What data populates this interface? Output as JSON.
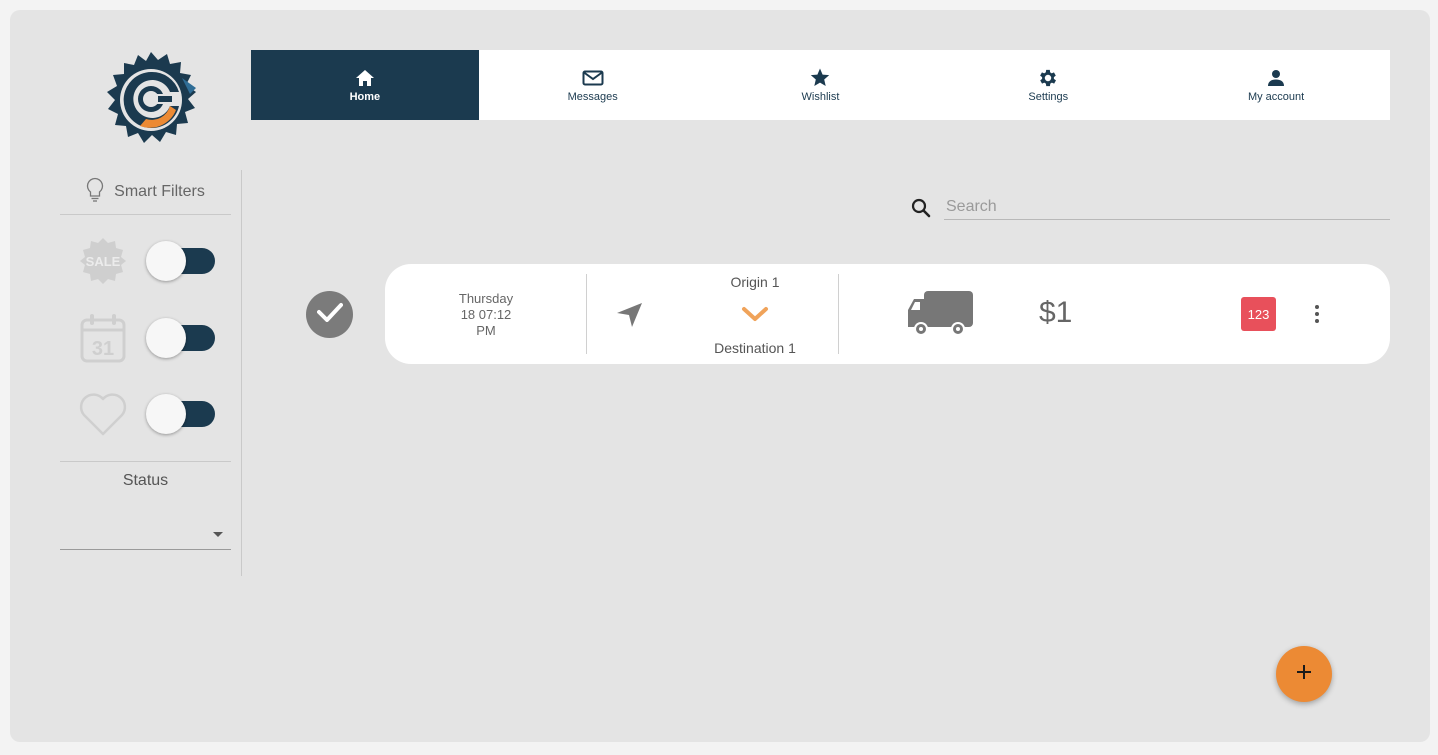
{
  "nav": {
    "items": [
      {
        "label": "Home",
        "icon": "home-icon",
        "active": true
      },
      {
        "label": "Messages",
        "icon": "envelope-icon",
        "active": false
      },
      {
        "label": "Wishlist",
        "icon": "star-icon",
        "active": false
      },
      {
        "label": "Settings",
        "icon": "gear-icon",
        "active": false
      },
      {
        "label": "My account",
        "icon": "person-icon",
        "active": false
      }
    ]
  },
  "sidebar": {
    "smart_filters_label": "Smart Filters",
    "filters": [
      {
        "icon": "sale-badge-icon",
        "badge_text": "SALE",
        "enabled": true
      },
      {
        "icon": "calendar-icon",
        "day": "31",
        "enabled": true
      },
      {
        "icon": "heart-icon",
        "enabled": true
      }
    ],
    "status_label": "Status",
    "status_value": ""
  },
  "search": {
    "placeholder": "Search",
    "value": ""
  },
  "shipment": {
    "day": "Thursday",
    "datetime": "18 07:12",
    "ampm": "PM",
    "origin": "Origin 1",
    "destination": "Destination 1",
    "price": "$1",
    "badge": "123",
    "selected": true
  },
  "colors": {
    "primary": "#1b3a4f",
    "accent": "#ec8a34",
    "badge": "#e8505b",
    "chevron": "#f0a35a",
    "icon_gray": "#777777"
  }
}
